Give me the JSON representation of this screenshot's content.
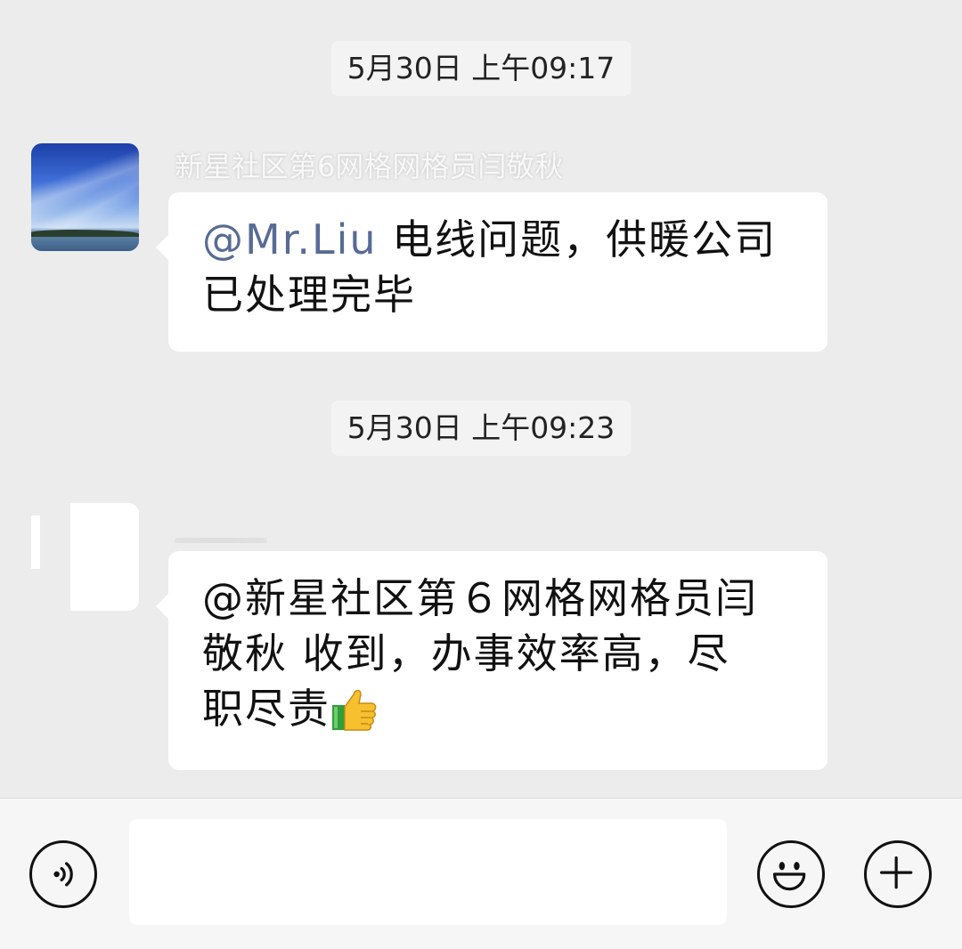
{
  "messages": [
    {
      "timestamp": "5月30日 上午09:17",
      "sender": "新星社区第6网格网格员闫敬秋",
      "mention": "@Mr.Liu",
      "text_line1": " 电线问题，供暖公司",
      "text_line2": "已处理完毕"
    },
    {
      "timestamp": "5月30日 上午09:23",
      "line1": "@新星社区第６网格网格员闫",
      "line2": "敬秋  收到，办事效率高，尽",
      "line3": "职尽责",
      "emoji": "thumbs-up"
    }
  ],
  "input_bar": {
    "placeholder": "",
    "voice_icon": "voice-icon",
    "emoji_icon": "emoji-icon",
    "plus_icon": "plus-icon"
  },
  "colors": {
    "background": "#ececec",
    "bubble": "#ffffff",
    "mention_link": "#576b95",
    "input_bar": "#f6f6f6"
  }
}
